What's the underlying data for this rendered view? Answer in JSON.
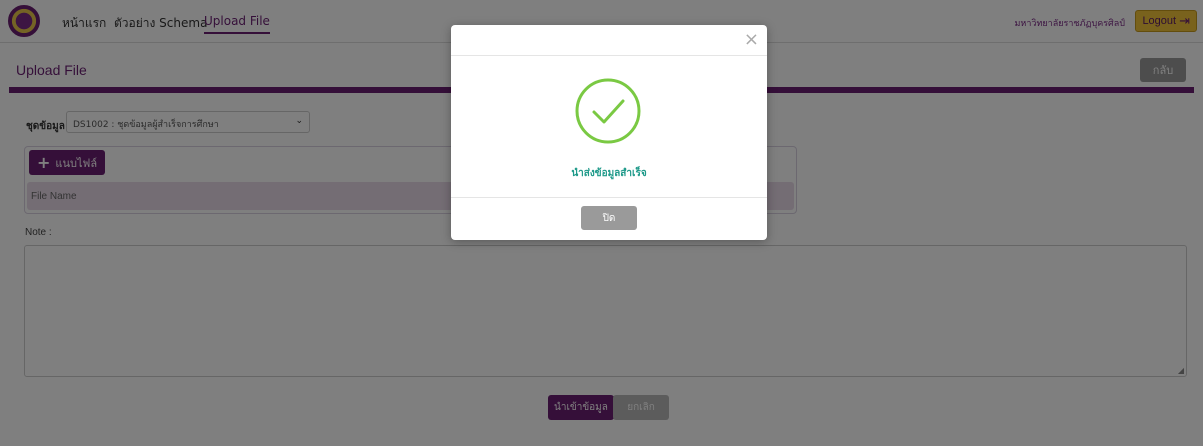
{
  "nav": {
    "home": "หน้าแรก",
    "schema_example": "ตัวอย่าง Schema",
    "upload_file": "Upload File",
    "university": "มหาวิทยาลัยราชภัฏบุครศิลป์",
    "logout": "Logout"
  },
  "page": {
    "title": "Upload File",
    "back_label": "กลับ"
  },
  "form": {
    "dataset_label": "ชุดข้อมูล",
    "dataset_value": "DS1002 : ชุดข้อมูลผู้สำเร็จการศึกษา",
    "attach_label": "แนบไฟล์",
    "file_name_header": "File Name",
    "note_label": "Note :",
    "import_label": "นำเข้าข้อมูล",
    "cancel_label": "ยกเลิก"
  },
  "modal": {
    "message": "นำส่งข้อมูลสำเร็จ",
    "close_button_label": "ปิด",
    "close_icon": "×"
  },
  "icons": {
    "logout": "logout-icon",
    "plus": "plus-icon",
    "check": "check-circle-icon",
    "close": "close-icon",
    "chevron": "chevron-down-icon"
  },
  "colors": {
    "brand_purple": "#6b1f73",
    "logout_yellow": "#f3c43b",
    "success_green": "#7ac943",
    "success_text": "#1f9a8a"
  }
}
